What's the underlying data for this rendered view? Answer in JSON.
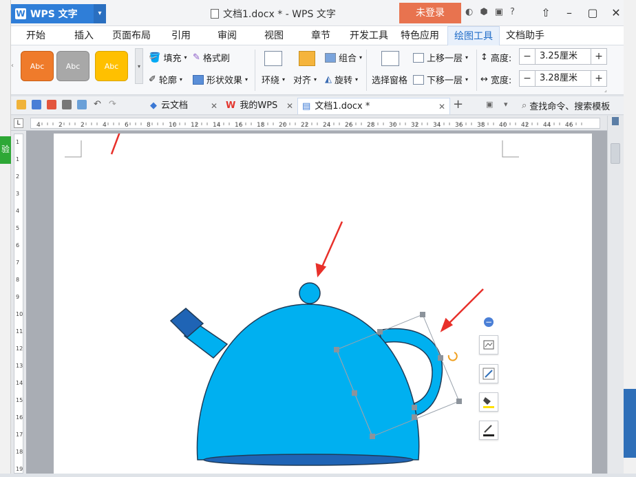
{
  "app": {
    "name": "WPS 文字",
    "title": "文档1.docx * - WPS 文字",
    "login_label": "未登录"
  },
  "menu": {
    "tabs": [
      "开始",
      "插入",
      "页面布局",
      "引用",
      "审阅",
      "视图",
      "章节",
      "开发工具",
      "特色应用",
      "绘图工具",
      "文档助手"
    ],
    "active": "绘图工具"
  },
  "ribbon": {
    "styles": [
      {
        "label": "Abc",
        "color": "#ef7b2b"
      },
      {
        "label": "Abc",
        "color": "#a8a8a8"
      },
      {
        "label": "Abc",
        "color": "#ffc000"
      }
    ],
    "fill": "填充",
    "format_painter": "格式刷",
    "outline": "轮廓",
    "shape_effect": "形状效果",
    "wrap": "环绕",
    "align": "对齐",
    "group": "组合",
    "rotate": "旋转",
    "select_pane": "选择窗格",
    "bring_forward": "上移一层",
    "send_backward": "下移一层",
    "height_label": "高度:",
    "height_value": "3.25厘米",
    "width_label": "宽度:",
    "width_value": "3.28厘米"
  },
  "tabs": {
    "cloud": "云文档",
    "mywps": "我的WPS",
    "doc": "文档1.docx *",
    "search": "查找命令、搜索模板"
  },
  "colors": {
    "accent": "#2f7ed8",
    "login": "#e8734f",
    "shape_fill": "#00b0f0",
    "shape_stroke": "#1f3b57",
    "spout_tip": "#1f64b5",
    "arrow": "#e8302a"
  },
  "ruler": {
    "h_labels": [
      "4",
      "2",
      "2",
      "4",
      "6",
      "8",
      "10",
      "12",
      "14",
      "16",
      "18",
      "20",
      "22",
      "24",
      "26",
      "28",
      "30",
      "32",
      "34",
      "36",
      "38",
      "40",
      "42",
      "44",
      "46"
    ],
    "v_labels": [
      "1",
      "1",
      "2",
      "3",
      "4",
      "5",
      "6",
      "7",
      "8",
      "9",
      "10",
      "11",
      "12",
      "13",
      "14",
      "15",
      "16",
      "17",
      "18",
      "19"
    ]
  }
}
